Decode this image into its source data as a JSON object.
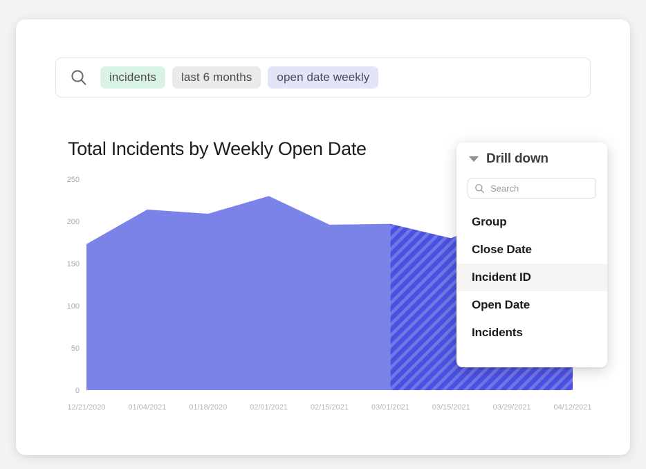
{
  "search": {
    "icon": "search-icon",
    "chips": [
      {
        "label": "incidents",
        "style": "green"
      },
      {
        "label": "last 6 months",
        "style": "gray"
      },
      {
        "label": "open date weekly",
        "style": "purple"
      }
    ]
  },
  "chart_data": {
    "type": "area",
    "title": "Total Incidents by Weekly Open Date",
    "xlabel": "",
    "ylabel": "",
    "ylim": [
      0,
      250
    ],
    "yticks": [
      0,
      50,
      100,
      150,
      200,
      250
    ],
    "grid": false,
    "legend": null,
    "categories": [
      "12/21/2020",
      "01/04/2021",
      "01/18/2020",
      "02/01/2021",
      "02/15/2021",
      "03/01/2021",
      "03/15/2021",
      "03/29/2021",
      "04/12/2021"
    ],
    "values": [
      173,
      214,
      209,
      230,
      196,
      197,
      180,
      212,
      228
    ],
    "series": [
      {
        "name": "Total Incidents",
        "values": [
          173,
          214,
          209,
          230,
          196,
          197,
          180,
          212,
          228
        ]
      }
    ],
    "annotations": [
      {
        "type": "projection-hatch",
        "from": "03/01/2021",
        "to": "04/12/2021",
        "note": "hatched (striped) region indicating partial/projected data"
      }
    ],
    "colors": {
      "area": "#7b82e8",
      "hatch_base": "#4a51e0",
      "hatch_stripe": "#7b82e8",
      "axis_text": "#b0b0b5"
    }
  },
  "drilldown": {
    "title": "Drill down",
    "caret_icon": "caret-down-icon",
    "search": {
      "icon": "search-icon",
      "placeholder": "Search",
      "value": ""
    },
    "items": [
      {
        "label": "Group",
        "active": false
      },
      {
        "label": "Close Date",
        "active": false
      },
      {
        "label": "Incident ID",
        "active": true
      },
      {
        "label": "Open Date",
        "active": false
      },
      {
        "label": "Incidents",
        "active": false
      }
    ]
  }
}
